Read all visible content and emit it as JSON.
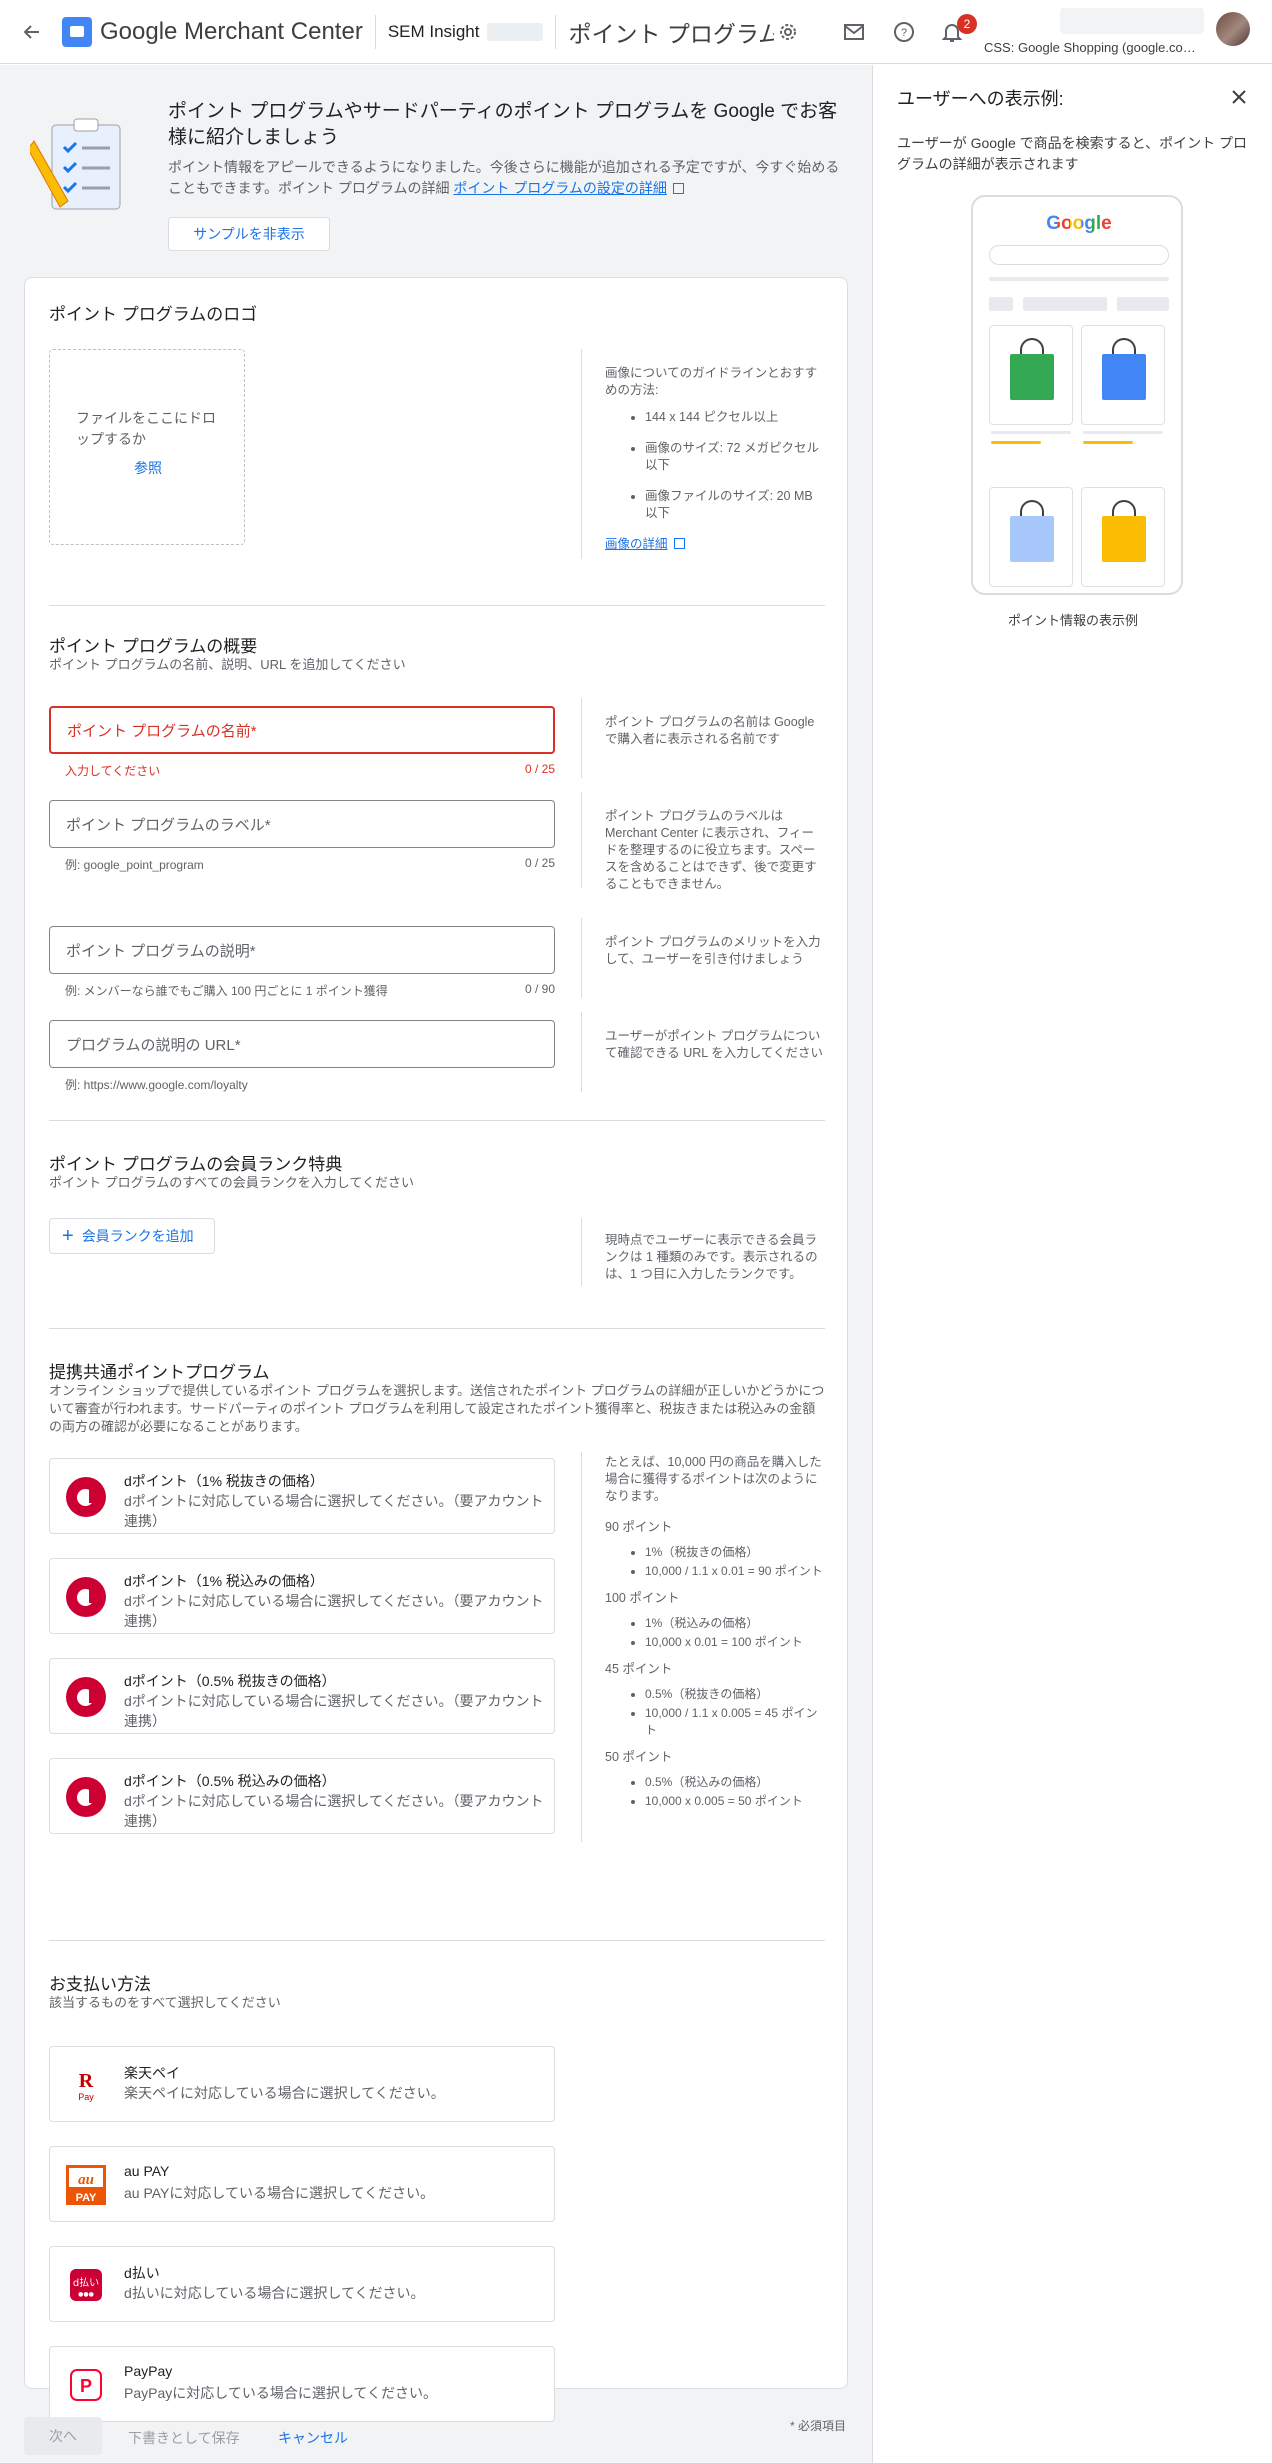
{
  "topbar": {
    "brand": "Google Merchant Center",
    "account": "SEM Insight",
    "page_title": "ポイント プログラム...",
    "notification_count": "2",
    "css_label": "CSS: Google Shopping (google.com/sh..."
  },
  "banner": {
    "title": "ポイント プログラムやサードパーティのポイント プログラムを Google でお客様に紹介しましょう",
    "body": "ポイント情報をアピールできるようになりました。今後さらに機能が追加される予定ですが、今すぐ始めることもできます。ポイント プログラムの詳細",
    "link": "ポイント プログラムの設定の詳細",
    "hide_button": "サンプルを非表示"
  },
  "logo_section": {
    "title": "ポイント プログラムのロゴ",
    "drop_text": "ファイルをここにドロップするか",
    "browse": "参照",
    "guide_intro": "画像についてのガイドラインとおすすめの方法:",
    "guides": [
      "144 x 144 ピクセル以上",
      "画像のサイズ: 72 メガピクセル以下",
      "画像ファイルのサイズ: 20 MB 以下"
    ],
    "guide_link": "画像の詳細"
  },
  "overview": {
    "title": "ポイント プログラムの概要",
    "subtitle": "ポイント プログラムの名前、説明、URL を追加してください",
    "name": {
      "placeholder": "ポイント プログラムの名前*",
      "error": "入力してください",
      "count": "0 / 25",
      "hint": "ポイント プログラムの名前は Google で購入者に表示される名前です"
    },
    "label": {
      "placeholder": "ポイント プログラムのラベル*",
      "example": "例: google_point_program",
      "count": "0 / 25",
      "hint": "ポイント プログラムのラベルは Merchant Center に表示され、フィードを整理するのに役立ちます。スペースを含めることはできず、後で変更することもできません。"
    },
    "description": {
      "placeholder": "ポイント プログラムの説明*",
      "example": "例: メンバーなら誰でもご購入 100 円ごとに 1 ポイント獲得",
      "count": "0 / 90",
      "hint": "ポイント プログラムのメリットを入力して、ユーザーを引き付けましょう"
    },
    "url": {
      "placeholder": "プログラムの説明の URL*",
      "example": "例: https://www.google.com/loyalty",
      "hint": "ユーザーがポイント プログラムについて確認できる URL を入力してください"
    }
  },
  "tiers": {
    "title": "ポイント プログラムの会員ランク特典",
    "subtitle": "ポイント プログラムのすべての会員ランクを入力してください",
    "add_button": "会員ランクを追加",
    "hint": "現時点でユーザーに表示できる会員ランクは 1 種類のみです。表示されるのは、1 つ目に入力したランクです。"
  },
  "partner": {
    "title": "提携共通ポイントプログラム",
    "subtitle": "オンライン ショップで提供しているポイント プログラムを選択します。送信されたポイント プログラムの詳細が正しいかどうかについて審査が行われます。サードパーティのポイント プログラムを利用して設定されたポイント獲得率と、税抜きまたは税込みの金額の両方の確認が必要になることがあります。",
    "options": [
      {
        "title": "dポイント（1% 税抜きの価格）",
        "desc": "dポイントに対応している場合に選択してください。（要アカウント連携）"
      },
      {
        "title": "dポイント（1% 税込みの価格）",
        "desc": "dポイントに対応している場合に選択してください。（要アカウント連携）"
      },
      {
        "title": "dポイント（0.5% 税抜きの価格）",
        "desc": "dポイントに対応している場合に選択してください。（要アカウント連携）"
      },
      {
        "title": "dポイント（0.5% 税込みの価格）",
        "desc": "dポイントに対応している場合に選択してください。（要アカウント連携）"
      }
    ],
    "hint_intro": "たとえば、10,000 円の商品を購入した場合に獲得するポイントは次のようになります。",
    "examples": [
      {
        "label": "90 ポイント",
        "lines": [
          "1%（税抜きの価格）",
          "10,000 / 1.1 x 0.01 = 90 ポイント"
        ]
      },
      {
        "label": "100 ポイント",
        "lines": [
          "1%（税込みの価格）",
          "10,000 x 0.01 = 100 ポイント"
        ]
      },
      {
        "label": "45 ポイント",
        "lines": [
          "0.5%（税抜きの価格）",
          "10,000 / 1.1 x 0.005 = 45 ポイント"
        ]
      },
      {
        "label": "50 ポイント",
        "lines": [
          "0.5%（税込みの価格）",
          "10,000 x 0.005 = 50 ポイント"
        ]
      }
    ]
  },
  "payment": {
    "title": "お支払い方法",
    "subtitle": "該当するものをすべて選択してください",
    "options": [
      {
        "title": "楽天ペイ",
        "desc": "楽天ペイに対応している場合に選択してください。",
        "logo_text": "R Pay"
      },
      {
        "title": "au PAY",
        "desc": "au PAYに対応している場合に選択してください。",
        "logo_text": "au PAY"
      },
      {
        "title": "d払い",
        "desc": "d払いに対応している場合に選択してください。",
        "logo_text": "d払い"
      },
      {
        "title": "PayPay",
        "desc": "PayPayに対応している場合に選択してください。",
        "logo_text": "P"
      }
    ]
  },
  "footer": {
    "next": "次へ",
    "draft": "下書きとして保存",
    "cancel": "キャンセル",
    "required": "* 必須項目"
  },
  "side_panel": {
    "title": "ユーザーへの表示例:",
    "description": "ユーザーが Google で商品を検索すると、ポイント プログラムの詳細が表示されます",
    "caption": "ポイント情報の表示例",
    "google_logo": "Google"
  },
  "colors": {
    "primary": "#1a73e8",
    "error": "#d93025",
    "dpoint": "#cc0033",
    "au": "#eb5505",
    "paypay": "#ff0033",
    "rakuten": "#bf0000"
  }
}
